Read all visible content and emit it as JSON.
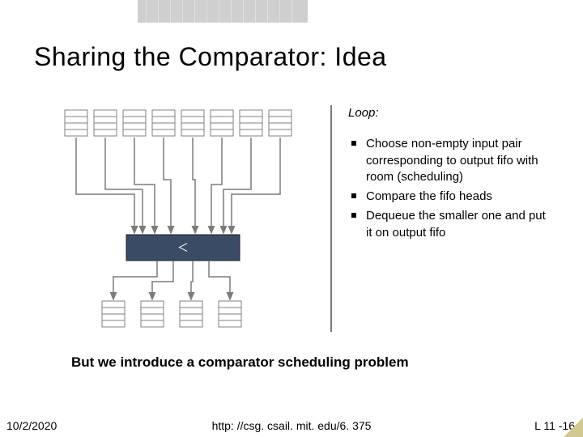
{
  "title": "Sharing the Comparator: Idea",
  "loop_label": "Loop:",
  "steps": [
    "Choose non-empty input pair corresponding to output fifo with room (scheduling)",
    "Compare the fifo heads",
    "Dequeue the smaller one and put it on output fifo"
  ],
  "caption": "But we introduce a comparator scheduling problem",
  "date": "10/2/2020",
  "url": "http: //csg. csail. mit. edu/6. 375",
  "page": "L 11 -16",
  "comparator_label": "<",
  "diagram": {
    "input_fifo_count": 8,
    "output_fifo_count": 4,
    "fifo_slots": 4
  }
}
